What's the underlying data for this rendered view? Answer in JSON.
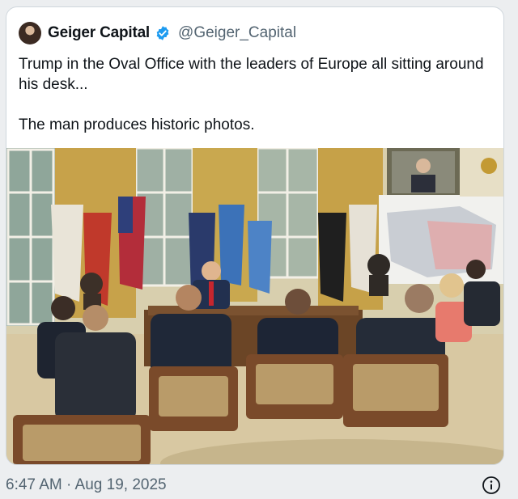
{
  "post": {
    "author_name": "Geiger Capital",
    "author_handle": "@Geiger_Capital",
    "verified": true,
    "text": "Trump in the Oval Office with the leaders of Europe all sitting around his desk...\n\nThe man produces historic photos.",
    "timestamp": "6:47 AM · Aug 19, 2025"
  },
  "colors": {
    "verified_blue": "#1d9bf0",
    "secondary_text": "#536471"
  },
  "icons": [
    "verified-badge-icon",
    "info-icon"
  ]
}
